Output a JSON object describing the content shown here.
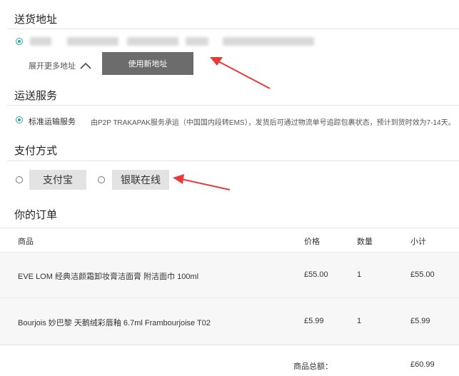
{
  "shipping_address": {
    "title": "送货地址",
    "show_more_label": "展开更多地址",
    "new_address_button": "使用新地址"
  },
  "delivery": {
    "title": "运送服务",
    "option_label": "标准运输服务",
    "option_desc": "由P2P TRAKAPAK服务承运（中国国内段转EMS），发货后可通过物流单号追踪包裹状态，预计到货时效为7-14天。"
  },
  "payment": {
    "title": "支付方式",
    "options": [
      "支付宝",
      "银联在线"
    ]
  },
  "order": {
    "title": "你的订单",
    "headers": {
      "product": "商品",
      "price": "价格",
      "qty": "数量",
      "subtotal": "小计"
    },
    "rows": [
      {
        "product": "EVE LOM 经典洁颜霜卸妆膏洁面膏 附洁面巾 100ml",
        "price": "£55.00",
        "qty": "1",
        "subtotal": "£55.00"
      },
      {
        "product": "Bourjois 妙巴黎 天鹅绒彩唇釉 6.7ml Frambourjoise T02",
        "price": "£5.99",
        "qty": "1",
        "subtotal": "£5.99"
      }
    ],
    "total_label": "商品总额：",
    "total_value": "£60.99"
  },
  "colors": {
    "accent": "#2aa89a",
    "annotation_arrow": "#e83a3a"
  }
}
